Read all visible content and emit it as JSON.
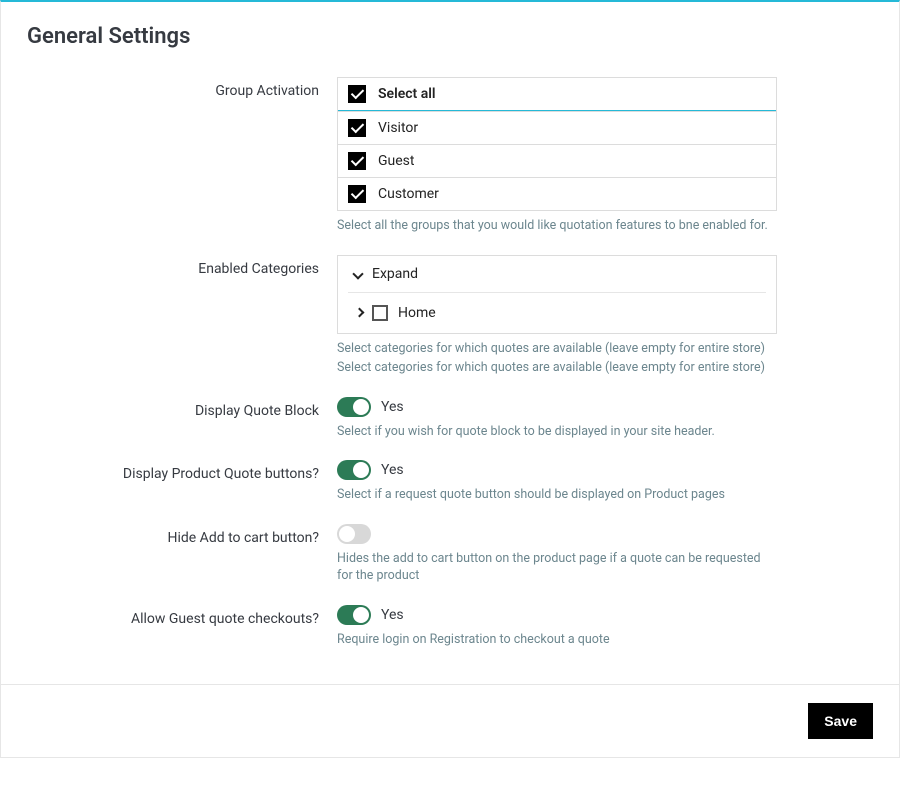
{
  "page": {
    "title": "General Settings"
  },
  "groupActivation": {
    "label": "Group Activation",
    "selectAllLabel": "Select all",
    "items": [
      {
        "label": "Visitor",
        "checked": true
      },
      {
        "label": "Guest",
        "checked": true
      },
      {
        "label": "Customer",
        "checked": true
      }
    ],
    "help": "Select all the groups that you would like quotation features to bne enabled for."
  },
  "enabledCategories": {
    "label": "Enabled Categories",
    "expandLabel": "Expand",
    "rootLabel": "Home",
    "help1": "Select categories for which quotes are available (leave empty for entire store)",
    "help2": "Select categories for which quotes are available (leave empty for entire store)"
  },
  "displayQuoteBlock": {
    "label": "Display Quote Block",
    "valueLabel": "Yes",
    "on": true,
    "help": "Select if you wish for quote block to be displayed in your site header."
  },
  "displayProductQuoteButtons": {
    "label": "Display Product Quote buttons?",
    "valueLabel": "Yes",
    "on": true,
    "help": "Select if a request quote button should be displayed on Product pages"
  },
  "hideAddToCart": {
    "label": "Hide Add to cart button?",
    "valueLabel": "",
    "on": false,
    "help": "Hides the add to cart button on the product page if a quote can be requested for the product"
  },
  "allowGuestCheckout": {
    "label": "Allow Guest quote checkouts?",
    "valueLabel": "Yes",
    "on": true,
    "help": "Require login on Registration to checkout a quote"
  },
  "footer": {
    "saveLabel": "Save"
  }
}
